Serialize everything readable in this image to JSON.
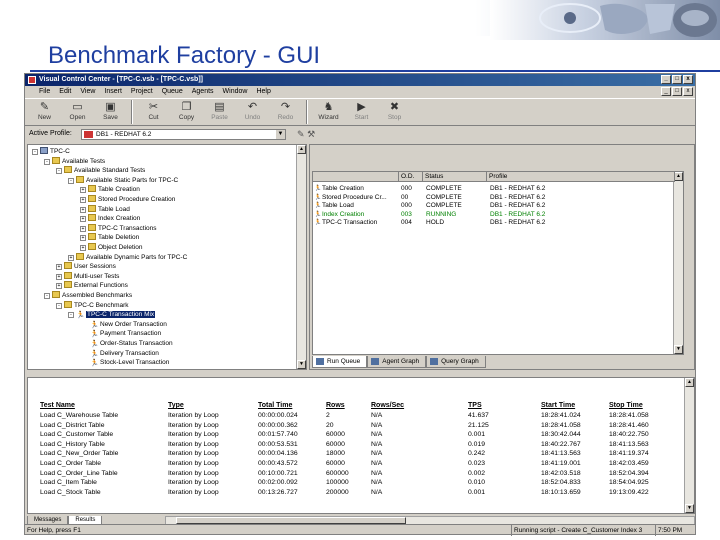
{
  "slide": {
    "title": "Benchmark Factory - GUI"
  },
  "window": {
    "title": "Visual Control Center - [TPC-C.vsb - [TPC-C.vsb]]",
    "min": "_",
    "max": "□",
    "close": "x"
  },
  "menu": [
    "File",
    "Edit",
    "View",
    "Insert",
    "Project",
    "Queue",
    "Agents",
    "Window",
    "Help"
  ],
  "toolbar": [
    {
      "label": "New",
      "icon": "new-icon",
      "glyph": "✎",
      "disabled": false
    },
    {
      "label": "Open",
      "icon": "open-icon",
      "glyph": "▭",
      "disabled": false
    },
    {
      "label": "Save",
      "icon": "save-icon",
      "glyph": "▣",
      "disabled": false
    },
    {
      "label": "Cut",
      "icon": "cut-icon",
      "glyph": "✂",
      "disabled": false
    },
    {
      "label": "Copy",
      "icon": "copy-icon",
      "glyph": "❐",
      "disabled": false
    },
    {
      "label": "Paste",
      "icon": "paste-icon",
      "glyph": "▤",
      "disabled": true
    },
    {
      "label": "Undo",
      "icon": "undo-icon",
      "glyph": "↶",
      "disabled": true
    },
    {
      "label": "Redo",
      "icon": "redo-icon",
      "glyph": "↷",
      "disabled": true
    },
    {
      "label": "Wizard",
      "icon": "wizard-icon",
      "glyph": "♞",
      "disabled": false
    },
    {
      "label": "Start",
      "icon": "start-icon",
      "glyph": "▶",
      "disabled": true
    },
    {
      "label": "Stop",
      "icon": "stop-icon",
      "glyph": "✖",
      "disabled": true
    }
  ],
  "profile": {
    "label": "Active Profile:",
    "value": "DB1 - REDHAT 6.2"
  },
  "tree": [
    {
      "label": "TPC-C",
      "depth": 0,
      "exp": "-",
      "icon": "pc"
    },
    {
      "label": "Available Tests",
      "depth": 1,
      "exp": "-",
      "icon": "folder"
    },
    {
      "label": "Available Standard Tests",
      "depth": 2,
      "exp": "-",
      "icon": "folder"
    },
    {
      "label": "Available Static Parts for TPC-C",
      "depth": 3,
      "exp": "-",
      "icon": "folder"
    },
    {
      "label": "Table Creation",
      "depth": 4,
      "exp": "+",
      "icon": "folder"
    },
    {
      "label": "Stored Procedure Creation",
      "depth": 4,
      "exp": "+",
      "icon": "folder"
    },
    {
      "label": "Table Load",
      "depth": 4,
      "exp": "+",
      "icon": "folder"
    },
    {
      "label": "Index Creation",
      "depth": 4,
      "exp": "+",
      "icon": "folder"
    },
    {
      "label": "TPC-C Transactions",
      "depth": 4,
      "exp": "+",
      "icon": "folder"
    },
    {
      "label": "Table Deletion",
      "depth": 4,
      "exp": "+",
      "icon": "folder"
    },
    {
      "label": "Object Deletion",
      "depth": 4,
      "exp": "+",
      "icon": "folder"
    },
    {
      "label": "Available Dynamic Parts for TPC-C",
      "depth": 3,
      "exp": "+",
      "icon": "folder"
    },
    {
      "label": "User Sessions",
      "depth": 2,
      "exp": "+",
      "icon": "folder"
    },
    {
      "label": "Multi-user Tests",
      "depth": 2,
      "exp": "+",
      "icon": "folder"
    },
    {
      "label": "External Functions",
      "depth": 2,
      "exp": "+",
      "icon": "folder"
    },
    {
      "label": "Assembled Benchmarks",
      "depth": 1,
      "exp": "-",
      "icon": "folder"
    },
    {
      "label": "TPC-C Benchmark",
      "depth": 2,
      "exp": "-",
      "icon": "folder"
    },
    {
      "label": "TPC-C Transaction Mix",
      "depth": 3,
      "exp": "-",
      "icon": "run",
      "selected": true
    },
    {
      "label": "New Order Transaction",
      "depth": 4,
      "exp": "",
      "icon": "run"
    },
    {
      "label": "Payment Transaction",
      "depth": 4,
      "exp": "",
      "icon": "run"
    },
    {
      "label": "Order-Status Transaction",
      "depth": 4,
      "exp": "",
      "icon": "run"
    },
    {
      "label": "Delivery Transaction",
      "depth": 4,
      "exp": "",
      "icon": "run"
    },
    {
      "label": "Stock-Level Transaction",
      "depth": 4,
      "exp": "",
      "icon": "run"
    }
  ],
  "queue": {
    "headers": [
      "",
      "O.D.",
      "Status",
      "Profile"
    ],
    "rows": [
      {
        "name": "Table Creation",
        "id": "000",
        "status": "COMPLETE",
        "profile": "DB1 - REDHAT 6.2",
        "running": false
      },
      {
        "name": "Stored Procedure Cr...",
        "id": "00",
        "status": "COMPLETE",
        "profile": "DB1 - REDHAT 6.2",
        "running": false
      },
      {
        "name": "Table Load",
        "id": "000",
        "status": "COMPLETE",
        "profile": "DB1 - REDHAT 6.2",
        "running": false
      },
      {
        "name": "Index Creation",
        "id": "003",
        "status": "RUNNING",
        "profile": "DB1 - REDHAT 6.2",
        "running": true
      },
      {
        "name": "TPC-C Transaction",
        "id": "004",
        "status": "HOLD",
        "profile": "DB1 - REDHAT 6.2",
        "running": false
      }
    ],
    "tabs": [
      "Run Queue",
      "Agent Graph",
      "Query Graph"
    ]
  },
  "results": {
    "headers": [
      "Test Name",
      "Type",
      "Total Time",
      "Rows",
      "Rows/Sec",
      "TPS",
      "Start Time",
      "Stop Time"
    ],
    "rows": [
      [
        "Load C_Warehouse Table",
        "Iteration by Loop",
        "00:00:00.024",
        "2",
        "N/A",
        "41.637",
        "18:28:41.024",
        "18:28:41.058"
      ],
      [
        "Load C_District Table",
        "Iteration by Loop",
        "00:00:00.362",
        "20",
        "N/A",
        "21.125",
        "18:28:41.058",
        "18:28:41.460"
      ],
      [
        "Load C_Customer Table",
        "Iteration by Loop",
        "00:01:57.740",
        "60000",
        "N/A",
        "0.001",
        "18:30:42.044",
        "18:40:22.750"
      ],
      [
        "Load C_History Table",
        "Iteration by Loop",
        "00:00:53.531",
        "60000",
        "N/A",
        "0.019",
        "18:40:22.767",
        "18:41:13.563"
      ],
      [
        "Load C_New_Order Table",
        "Iteration by Loop",
        "00:00:04.136",
        "18000",
        "N/A",
        "0.242",
        "18:41:13.563",
        "18:41:19.374"
      ],
      [
        "Load C_Order Table",
        "Iteration by Loop",
        "00:00:43.572",
        "60000",
        "N/A",
        "0.023",
        "18:41:19.001",
        "18:42:03.459"
      ],
      [
        "Load C_Order_Line Table",
        "Iteration by Loop",
        "00:10:00.721",
        "600000",
        "N/A",
        "0.002",
        "18:42:03.518",
        "18:52:04.394"
      ],
      [
        "Load C_Item Table",
        "Iteration by Loop",
        "00:02:00.092",
        "100000",
        "N/A",
        "0.010",
        "18:52:04.833",
        "18:54:04.925"
      ],
      [
        "Load C_Stock Table",
        "Iteration by Loop",
        "00:13:26.727",
        "200000",
        "N/A",
        "0.001",
        "18:10:13.659",
        "19:13:09.422"
      ]
    ],
    "tabs": [
      "Messages",
      "Results"
    ]
  },
  "status": {
    "left": "For Help, press F1",
    "middle": "Running script - Create C_Customer Index 3",
    "right": "7:50 PM"
  }
}
